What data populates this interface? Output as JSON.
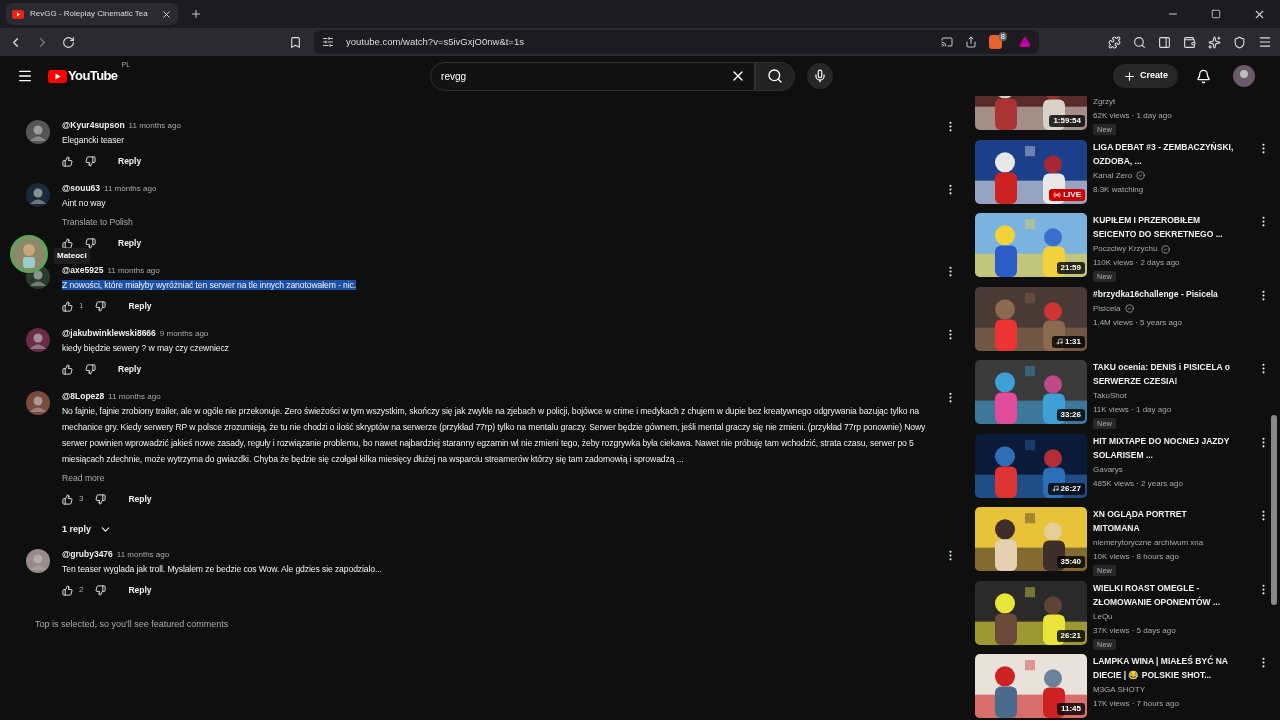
{
  "browser": {
    "tab_title": "RevGG - Roleplay Cinematic Tea",
    "url": "youtube.com/watch?v=s5ivGxjO0nw&t=1s",
    "shield_count": "8"
  },
  "header": {
    "logo": "YouTube",
    "region": "PL",
    "search_value": "revgg",
    "create": "Create"
  },
  "comments": [
    {
      "author": "@Kyur4supson",
      "time": "11 months ago",
      "text": "Elegancki teaser",
      "highlighted": false,
      "reply": "Reply"
    },
    {
      "author": "@souu63",
      "time": "11 months ago",
      "text": "Aint no way",
      "translate": "Translate to Polish",
      "highlighted": false,
      "reply": "Reply"
    },
    {
      "author": "@axe5925",
      "time": "11 months ago",
      "text": "Z nowości, które miałyby wyróżniać ten serwer na tle innych zanotowałem - nic.",
      "highlighted": true,
      "likes": "1",
      "reply": "Reply"
    },
    {
      "author": "@jakubwinklewski8666",
      "time": "9 months ago",
      "text": "kiedy bіędzie sewery ? w   may  czy  czewniecz",
      "highlighted": false,
      "reply": "Reply"
    },
    {
      "author": "@8Lopez8",
      "time": "11 months ago",
      "text": "No fajnie, fajnie zrobiony trailer, ale w ogóle nie przekonuje. Zero świeżości w tym wszystkim, skończy się jak zwykle na zjebach w policji, bojówce w crime i medykach z chujem w dupie bez kreatywnego odgrywania bazując tylko na mechanice gry. Kiedy serwery RP w polsce zrozumieją, że tu nie chodzi o ilość skryptów na serwerze (przykład 77rp) tylko na mentalu graczy. Serwer będzie gównem, jeśli mental graczy się nie zmieni. (przykład 77rp ponownie) Nowy serwer powinien wprowadzić jakieś nowe zasady, reguły i rozwiązanie problemu, bo nawet najbardziej staranny egzamin wl nie zmieni tego, żeby rozgrywka była ciekawa. Nawet nie próbuję tam wchodzić, strata czasu, serwer po 5 miesiącach zdechnie, może wytrzyma do gwiazdki. Chyba że będzie się czołgał kilka miesięcy dłużej na wsparciu streamerów którzy się tam zadomowią i sprowadzą ...",
      "read_more": "Read more",
      "highlighted": false,
      "likes": "3",
      "reply": "Reply",
      "replies": "1 reply"
    },
    {
      "author": "@gruby3476",
      "time": "11 months ago",
      "text": "Ten teaser wyglada jak troll. Myslalem ze bedzie cos Wow. Ale gdzies sie zapodzialo...",
      "highlighted": false,
      "likes": "2",
      "reply": "Reply"
    }
  ],
  "footer_note": "Top is selected, so you'll see featured comments",
  "tooltip": "Mateoci",
  "videos": [
    {
      "channel": "Zgrzyt",
      "verified": false,
      "meta": "62K views · 1 day ago",
      "badge": "New",
      "duration": "1:59:54",
      "kind": "video"
    },
    {
      "title": "LIGA DEBAT #3 - ZEMBACZYŃSKI, OZDOBA, ...",
      "channel": "Kanal Zero",
      "verified": true,
      "meta": "8.3K watching",
      "duration": "LIVE",
      "kind": "live"
    },
    {
      "title": "KUPIŁEM I PRZEROBIŁEM SEICENTO DO SEKRETNEGO ...",
      "channel": "Poczciwy Krzychu",
      "verified": true,
      "meta": "110K views · 2 days ago",
      "badge": "New",
      "duration": "21:59",
      "kind": "video"
    },
    {
      "title": "#brzydka16challenge - Pisicela",
      "channel": "Pisicela",
      "verified": true,
      "meta": "1.4M views · 5 years ago",
      "duration": "1:31",
      "kind": "music"
    },
    {
      "title": "TAKU ocenia: DENIS i PISICELA o SERWERZE CZESIA!",
      "channel": "TakuShot",
      "verified": false,
      "meta": "11K views · 1 day ago",
      "badge": "New",
      "duration": "33:26",
      "kind": "video"
    },
    {
      "title": "HIT MIXTAPE DO NOCNEJ JAZDY SOLARISEM ...",
      "channel": "Gavarys",
      "verified": false,
      "meta": "485K views · 2 years ago",
      "duration": "26:27",
      "kind": "music"
    },
    {
      "title": "XN OGLĄDA PORTRET MITOMANA",
      "channel": "niemerytoryczne archiwum xna",
      "verified": false,
      "meta": "10K views · 8 hours ago",
      "badge": "New",
      "duration": "35:40",
      "kind": "video"
    },
    {
      "title": "WIELKI ROAST OMEGLE - ZŁOMOWANIE OPONENTÓW ...",
      "channel": "LeQu",
      "verified": false,
      "meta": "37K views · 5 days ago",
      "badge": "New",
      "duration": "26:21",
      "kind": "video"
    },
    {
      "title": "LAMPKA WINA | MIAŁEŚ BYĆ NA DIECIE | 😂 POLSKIE SHOT...",
      "channel": "M3GA SHOTY",
      "verified": false,
      "meta": "17K views · 7 hours ago",
      "duration": "11:45",
      "kind": "video"
    }
  ]
}
